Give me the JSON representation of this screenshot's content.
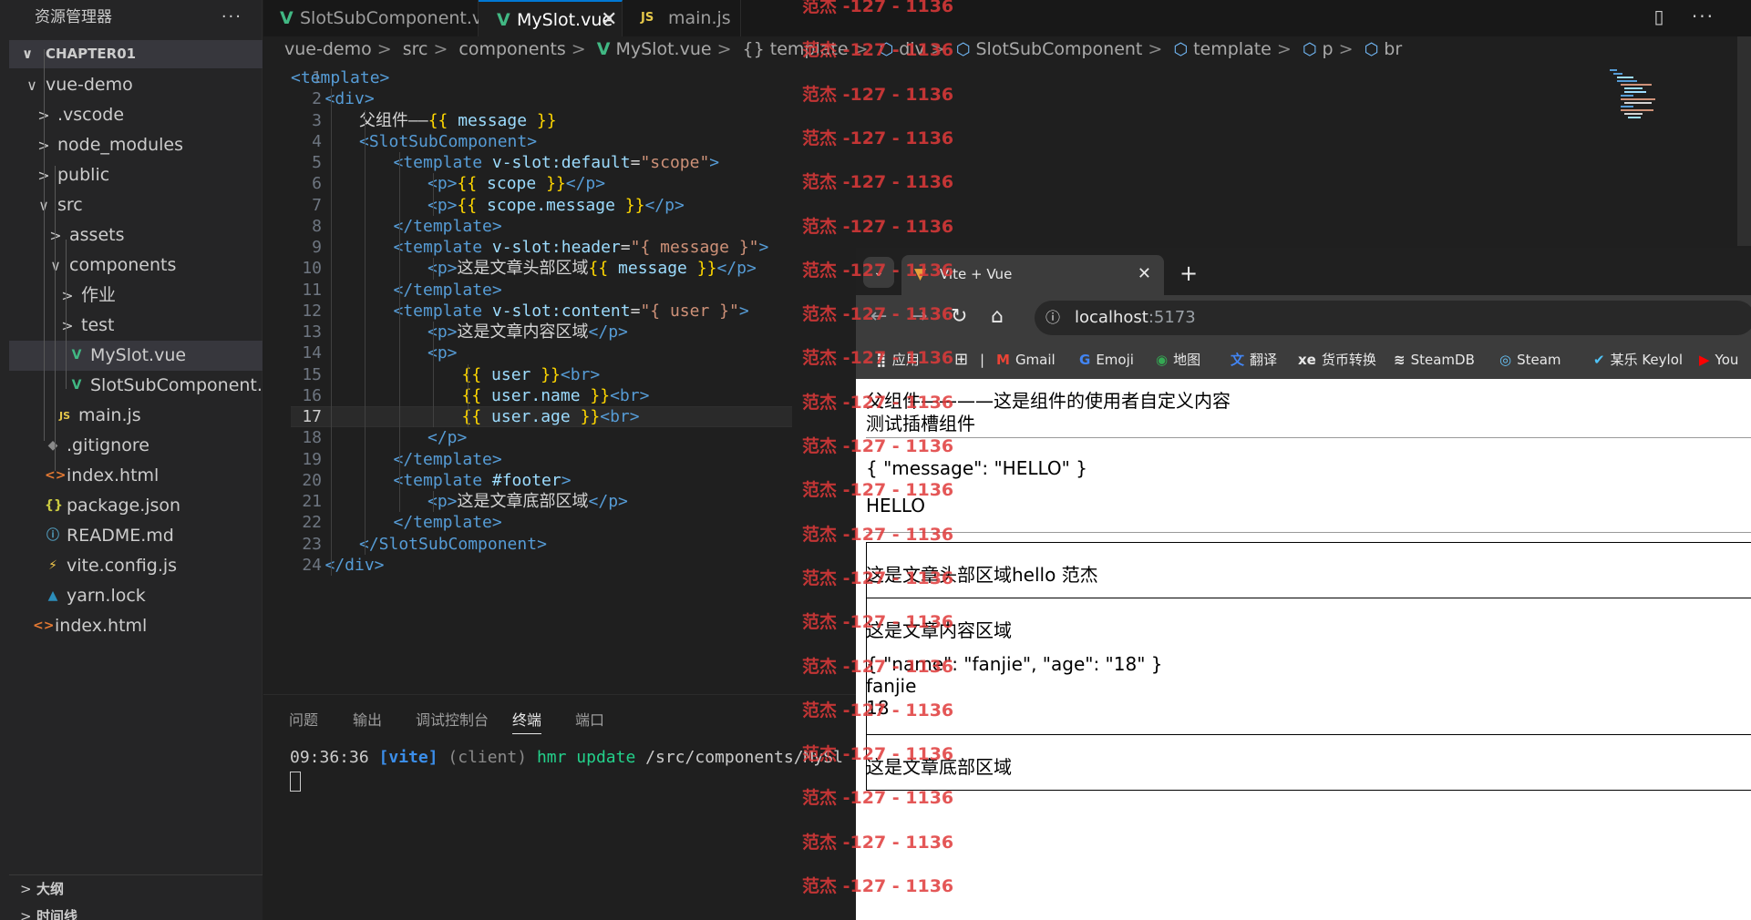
{
  "sidebar": {
    "title": "资源管理器",
    "more": "···",
    "section": "CHAPTER01",
    "tree": [
      {
        "label": "vue-demo",
        "chev": "∨"
      },
      {
        "label": ".vscode",
        "chev": ">"
      },
      {
        "label": "node_modules",
        "chev": ">"
      },
      {
        "label": "public",
        "chev": ">"
      },
      {
        "label": "src",
        "chev": "∨"
      },
      {
        "label": "assets",
        "chev": ">"
      },
      {
        "label": "components",
        "chev": "∨"
      },
      {
        "label": "作业",
        "chev": ">"
      },
      {
        "label": "test",
        "chev": ">"
      },
      {
        "label": "MySlot.vue",
        "icon": "V"
      },
      {
        "label": "SlotSubComponent....",
        "icon": "V"
      },
      {
        "label": "main.js",
        "icon": "JS"
      },
      {
        "label": ".gitignore",
        "icon": "◆"
      },
      {
        "label": "index.html",
        "icon": "<>"
      },
      {
        "label": "package.json",
        "icon": "{}"
      },
      {
        "label": "README.md",
        "icon": "ⓘ"
      },
      {
        "label": "vite.config.js",
        "icon": "⚡"
      },
      {
        "label": "yarn.lock",
        "icon": "▲"
      },
      {
        "label": "index.html",
        "icon": "<>"
      }
    ],
    "bottom": [
      "大纲",
      "时间线"
    ]
  },
  "tabs": [
    {
      "label": "SlotSubComponent.vue",
      "icon": "V"
    },
    {
      "label": "MySlot.vue",
      "icon": "V",
      "close": "✕"
    },
    {
      "label": "main.js",
      "icon": "JS"
    }
  ],
  "breadcrumb": [
    "vue-demo",
    "src",
    "components",
    "MySlot.vue",
    "{} template",
    "div",
    "SlotSubComponent",
    "template",
    "p",
    "br"
  ],
  "code": {
    "line_numbers": [
      "1",
      "2",
      "3",
      "4",
      "5",
      "6",
      "7",
      "8",
      "9",
      "10",
      "11",
      "12",
      "13",
      "14",
      "15",
      "16",
      "17",
      "18",
      "19",
      "20",
      "21",
      "22",
      "23",
      "24"
    ]
  },
  "panel": {
    "tabs": [
      "问题",
      "输出",
      "调试控制台",
      "终端",
      "端口"
    ],
    "terminal_line": {
      "time": "09:36:36 ",
      "tag": "[vite]",
      "rest1": " (client) ",
      "hmr": "hmr update ",
      "path": "/src/components/MySl"
    }
  },
  "watermark": "范杰 -127 - 1136",
  "browser": {
    "tab_title": "Vite + Vue",
    "tab_close": "✕",
    "new_tab": "+",
    "url_host": "localhost",
    "url_port": ":5173",
    "bookmarks": [
      "应用",
      "Gmail",
      "Emoji",
      "地图",
      "翻译",
      "货币转换",
      "SteamDB",
      "Steam",
      "某乐 Keylol",
      "You"
    ],
    "page": {
      "line1": "父组件————这是组件的使用者自定义内容",
      "line2": "测试插槽组件",
      "json1": "{ \"message\": \"HELLO\" }",
      "hello": "HELLO",
      "header": "这是文章头部区域hello 范杰",
      "content": "这是文章内容区域",
      "json2": "{ \"name\": \"fanjie\", \"age\": \"18\" }",
      "name": "fanjie",
      "age": "18",
      "footer": "这是文章底部区域"
    }
  },
  "colors": {
    "accent": "#0078d4",
    "vue": "#41b883",
    "watermark": "#e03a3a"
  }
}
